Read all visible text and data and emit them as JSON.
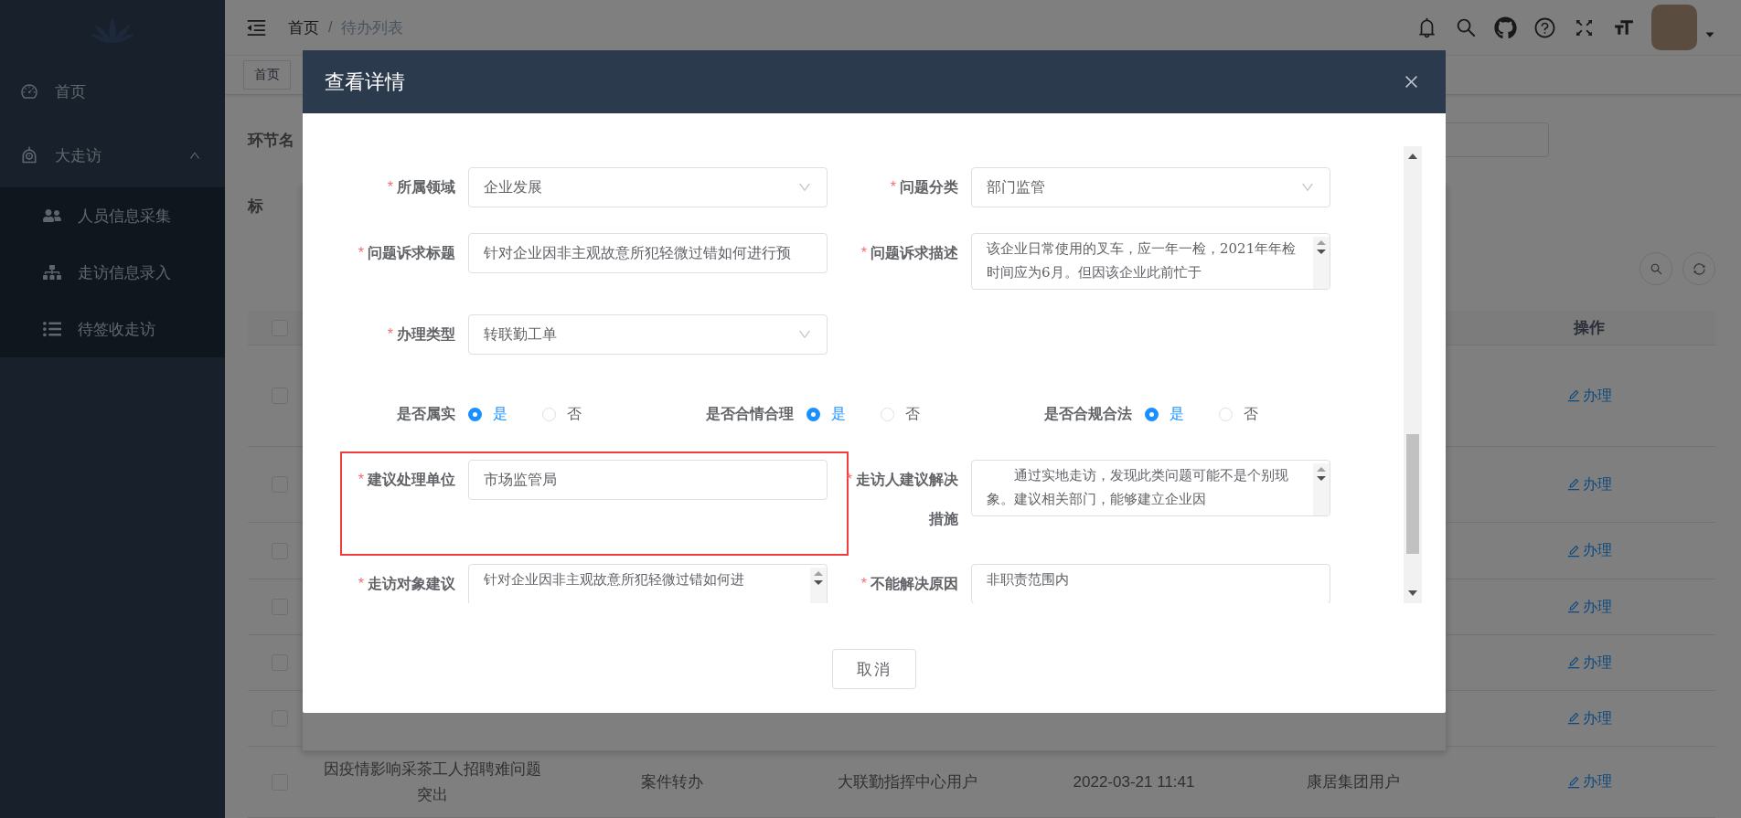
{
  "sidebar": {
    "items": [
      {
        "label": "首页"
      },
      {
        "label": "大走访",
        "expanded": true,
        "children": [
          {
            "label": "人员信息采集"
          },
          {
            "label": "走访信息录入"
          },
          {
            "label": "待签收走访"
          }
        ]
      }
    ]
  },
  "header": {
    "breadcrumb": [
      "首页",
      "待办列表"
    ],
    "separator": "/"
  },
  "tags": [
    {
      "label": "首页",
      "selected": false
    }
  ],
  "filters": [
    {
      "label": "环节名"
    },
    {
      "label": "标"
    }
  ],
  "table": {
    "header": {
      "checked": false,
      "action_column": "操作"
    },
    "rows": [
      {
        "checked": false,
        "cells": [],
        "action": "办理"
      },
      {
        "checked": false,
        "cells": [],
        "action": "办理"
      },
      {
        "checked": false,
        "cells": [],
        "action": "办理"
      },
      {
        "checked": false,
        "cells": [],
        "action": "办理"
      },
      {
        "checked": false,
        "cells": [],
        "action": "办理"
      },
      {
        "checked": false,
        "cells": [],
        "action": "办理"
      },
      {
        "checked": false,
        "cells": [
          "因疫情影响采茶工人招聘难问题突出",
          "案件转办",
          "大联勤指挥中心用户",
          "2022-03-21 11:41",
          "康居集团用户"
        ],
        "action": "办理"
      }
    ]
  },
  "modal": {
    "title": "查看详情",
    "cancel": "取消",
    "rows": [
      {
        "fields": [
          {
            "kind": "select",
            "label": "所属领域",
            "required_mark": "*",
            "value": "企业发展",
            "highlighted": false
          },
          {
            "kind": "select",
            "label": "问题分类",
            "required_mark": "*",
            "value": "部门监管",
            "highlighted": false
          }
        ]
      },
      {
        "fields": [
          {
            "kind": "input",
            "label": "问题诉求标题",
            "required_mark": "*",
            "value": "针对企业因非主观故意所犯轻微过错如何进行预",
            "highlighted": false
          },
          {
            "kind": "textarea",
            "label": "问题诉求描述",
            "required_mark": "*",
            "value": "该企业日常使用的叉车，应一年一检，2021年年检时间应为6月。但因该企业此前忙于",
            "highlighted": false
          }
        ]
      },
      {
        "fields": [
          {
            "kind": "select",
            "label": "办理类型",
            "required_mark": "*",
            "value": "转联勤工单",
            "highlighted": false
          }
        ]
      },
      {
        "fields": [
          {
            "kind": "radio",
            "label": "是否属实",
            "options": [
              {
                "label": "是",
                "selected": true
              },
              {
                "label": "否",
                "selected": false
              }
            ]
          },
          {
            "kind": "radio",
            "label": "是否合情合理",
            "options": [
              {
                "label": "是",
                "selected": true
              },
              {
                "label": "否",
                "selected": false
              }
            ]
          },
          {
            "kind": "radio",
            "label": "是否合规合法",
            "options": [
              {
                "label": "是",
                "selected": true
              },
              {
                "label": "否",
                "selected": false
              }
            ]
          }
        ]
      },
      {
        "fields": [
          {
            "kind": "input",
            "label": "建议处理单位",
            "required_mark": "*",
            "value": "市场监管局",
            "highlighted": true
          },
          {
            "kind": "textarea",
            "label": "走访人建议解决措施",
            "required_mark": "*",
            "value": "　　通过实地走访，发现此类问题可能不是个别现象。建议相关部门，能够建立企业因",
            "highlighted": false
          }
        ]
      },
      {
        "fields": [
          {
            "kind": "textarea",
            "label": "走访对象建议",
            "required_mark": "*",
            "value": "针对企业因非主观故意所犯轻微过错如何进",
            "highlighted": false
          },
          {
            "kind": "plaintext",
            "label": "不能解决原因",
            "required_mark": "*",
            "value": "非职责范围内",
            "highlighted": false
          }
        ]
      }
    ]
  }
}
